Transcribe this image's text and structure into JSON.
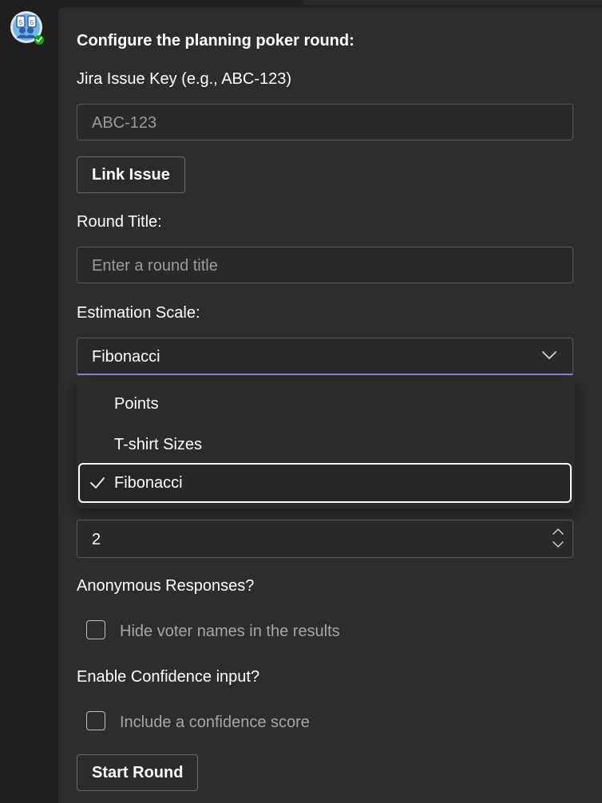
{
  "app": {
    "accent": "#7f85f5",
    "status_color": "#13a10e"
  },
  "form": {
    "heading": "Configure the planning poker round:",
    "jira": {
      "label": "Jira Issue Key (e.g., ABC-123)",
      "placeholder": "ABC-123",
      "value": "",
      "button_label": "Link Issue"
    },
    "round_title": {
      "label": "Round Title:",
      "placeholder": "Enter a round title",
      "value": ""
    },
    "scale": {
      "label": "Estimation Scale:",
      "selected": "Fibonacci",
      "options": [
        {
          "label": "Points",
          "selected": false
        },
        {
          "label": "T-shirt Sizes",
          "selected": false
        },
        {
          "label": "Fibonacci",
          "selected": true
        }
      ]
    },
    "number_field": {
      "value": "2"
    },
    "anonymous": {
      "label": "Anonymous Responses?",
      "checkbox_label": "Hide voter names in the results",
      "checked": false
    },
    "confidence": {
      "label": "Enable Confidence input?",
      "checkbox_label": "Include a confidence score",
      "checked": false
    },
    "start_button": "Start Round"
  }
}
